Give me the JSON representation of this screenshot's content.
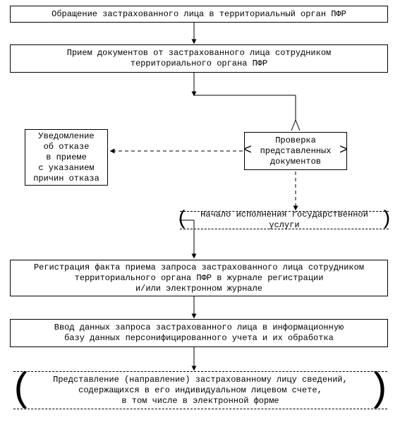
{
  "flow": {
    "step1": "Обращение застрахованного лица в территориальный орган ПФР",
    "step2": "Прием документов от застрахованного лица сотрудником\nтерриториального органа ПФР",
    "check": "Проверка\nпредставленных\nдокументов",
    "reject": "Уведомление\nоб отказе\nв приеме\nс указанием\nпричин отказа",
    "start_service": "Начало исполнения государственной услуги",
    "register": "Регистрация факта приема запроса застрахованного лица сотрудником\nтерриториального органа ПФР в журнале регистрации\nи/или электронном журнале",
    "input_data": "Ввод данных запроса застрахованного лица в информационную\nбазу данных персонифицированного учета и их обработка",
    "result": "Представление (направление) застрахованному лицу сведений,\nсодержащихся в его индивидуальном лицевом счете,\nв том числе в электронной форме"
  }
}
